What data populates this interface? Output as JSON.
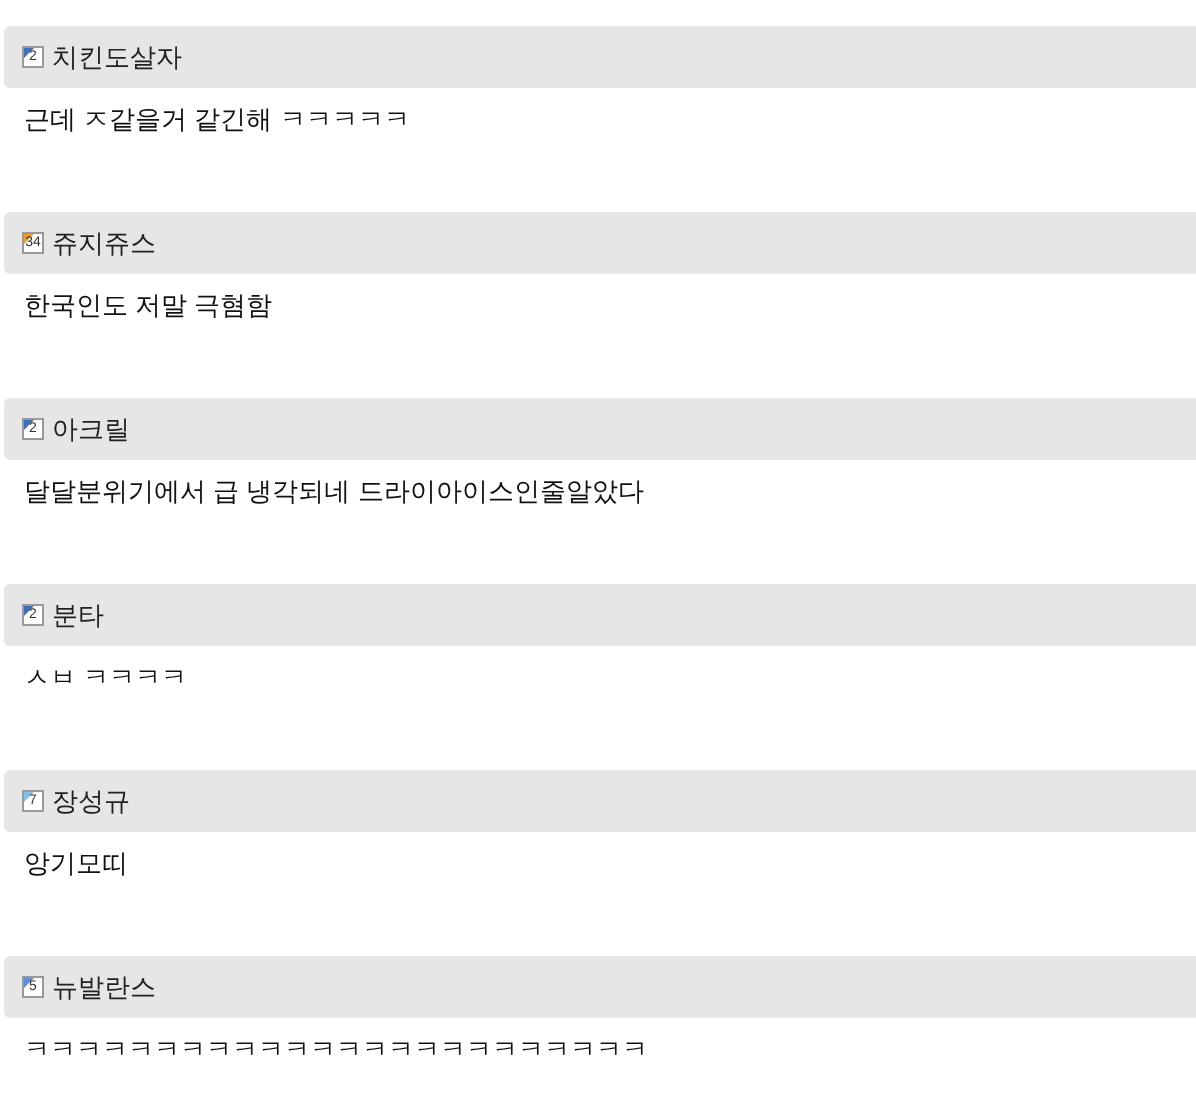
{
  "comments": [
    {
      "level": "2",
      "color": "#3a6fc4",
      "author": "치킨도살자",
      "text": "근데 ㅈ같을거 같긴해 ㅋㅋㅋㅋㅋ"
    },
    {
      "level": "34",
      "color": "#f59a1a",
      "author": "쥬지쥬스",
      "text": "한국인도 저말 극혐함"
    },
    {
      "level": "2",
      "color": "#3a6fc4",
      "author": "아크릴",
      "text": "달달분위기에서 급 냉각되네 드라이아이스인줄알았다"
    },
    {
      "level": "2",
      "color": "#3a6fc4",
      "author": "분타",
      "text": "ㅅㅂ ㅋㅋㅋㅋ"
    },
    {
      "level": "7",
      "color": "#7cc4f0",
      "author": "장성규",
      "text": "앙기모띠"
    },
    {
      "level": "5",
      "color": "#5a8fe0",
      "author": "뉴발란스",
      "text": "ㅋㅋㅋㅋㅋㅋㅋㅋㅋㅋㅋㅋㅋㅋㅋㅋㅋㅋㅋㅋㅋㅋㅋㅋ"
    }
  ]
}
